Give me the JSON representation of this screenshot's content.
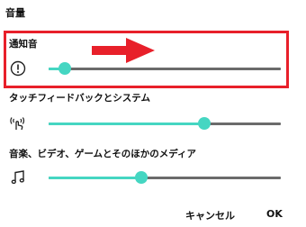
{
  "dialog": {
    "title": "音量"
  },
  "sections": [
    {
      "label": "通知音",
      "icon": "alert-circle-icon",
      "level": 0.07
    },
    {
      "label": "タッチフィードバックとシステム",
      "icon": "touch-vibration-icon",
      "level": 0.67
    },
    {
      "label": "音楽、ビデオ、ゲームとそのほかのメディア",
      "icon": "music-note-icon",
      "level": 0.4
    }
  ],
  "annotation": {
    "box_color": "#e8202a",
    "arrow_color": "#e8202a"
  },
  "colors": {
    "accent": "#45d6c2",
    "track": "#6b6b6b"
  },
  "buttons": {
    "cancel": "キャンセル",
    "ok": "OK"
  }
}
